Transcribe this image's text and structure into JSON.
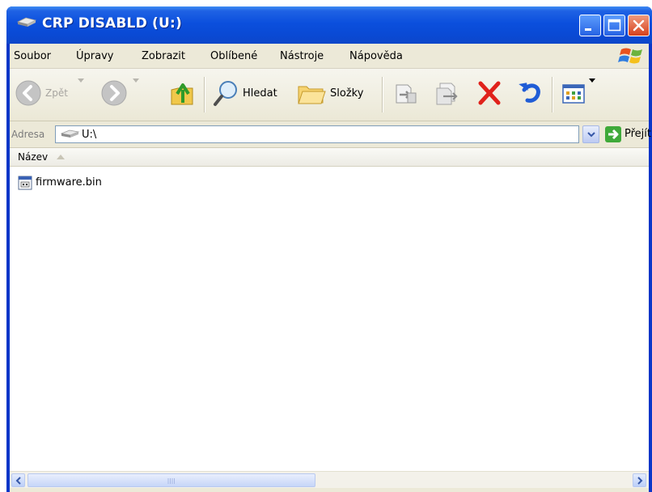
{
  "window": {
    "title": "CRP DISABLD (U:)",
    "title_icon": "drive-icon",
    "controls": [
      "minimize-icon",
      "maximize-icon",
      "close-icon"
    ]
  },
  "menubar": {
    "items": [
      {
        "label": "Soubor"
      },
      {
        "label": "Úpravy"
      },
      {
        "label": "Zobrazit"
      },
      {
        "label": "Oblíbené"
      },
      {
        "label": "Nástroje"
      },
      {
        "label": "Nápověda"
      }
    ]
  },
  "toolbar": {
    "back_label": "Zpět",
    "search_label": "Hledat",
    "folders_label": "Složky",
    "icons": [
      "back-arrow-icon",
      "forward-arrow-icon",
      "up-folder-icon",
      "search-icon",
      "folders-icon",
      "move-to-icon",
      "copy-to-icon",
      "delete-icon",
      "undo-icon",
      "views-icon"
    ]
  },
  "address": {
    "label": "Adresa",
    "value": "U:\\",
    "go_label": "Přejít"
  },
  "list": {
    "column_name": "Název",
    "files": [
      {
        "name": "firmware.bin",
        "icon": "bin-file-icon"
      }
    ]
  },
  "colors": {
    "titlebar": "#0b4fdd",
    "client_bg": "#ece9d8",
    "delete_red": "#e0221b",
    "undo_blue": "#1f5cd6"
  }
}
